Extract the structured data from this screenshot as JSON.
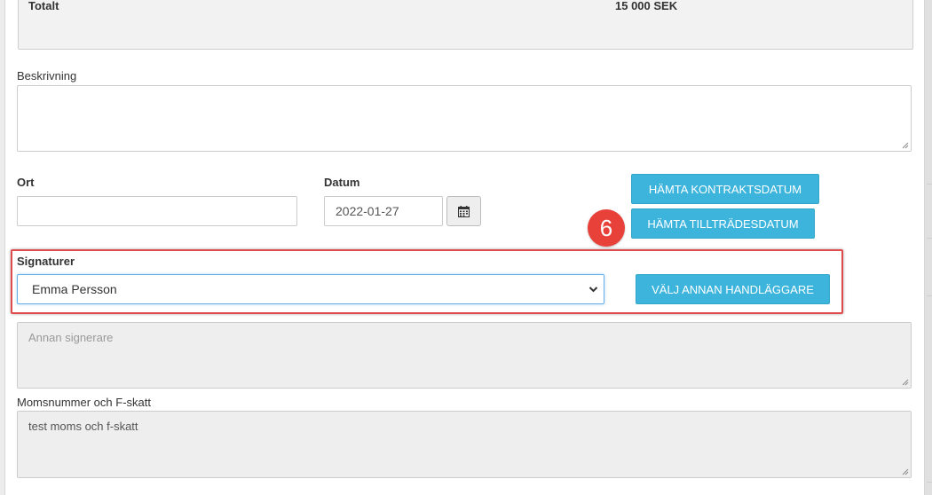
{
  "summary": {
    "total_label": "Totalt",
    "total_value": "15 000 SEK"
  },
  "form": {
    "description_label": "Beskrivning",
    "description_value": "",
    "ort_label": "Ort",
    "ort_value": "",
    "datum_label": "Datum",
    "datum_value": "2022-01-27",
    "signatures_label": "Signaturer",
    "signatures_selected": "Emma Persson",
    "other_signer_placeholder": "Annan signerare",
    "vat_label": "Momsnummer och F-skatt",
    "vat_value": "test moms och f-skatt"
  },
  "buttons": {
    "fetch_contract_date": "HÄMTA KONTRAKTSDATUM",
    "fetch_access_date": "HÄMTA TILLTRÄDESDATUM",
    "choose_other_handler": "VÄLJ ANNAN HANDLÄGGARE"
  },
  "annotation": {
    "step_number": "6"
  },
  "colors": {
    "accent_button": "#3cb4dc",
    "highlight_border": "#e04b4b",
    "badge": "#e8413a"
  },
  "icons": {
    "calendar": "calendar-icon",
    "select_arrow": "chevron-down-icon"
  }
}
